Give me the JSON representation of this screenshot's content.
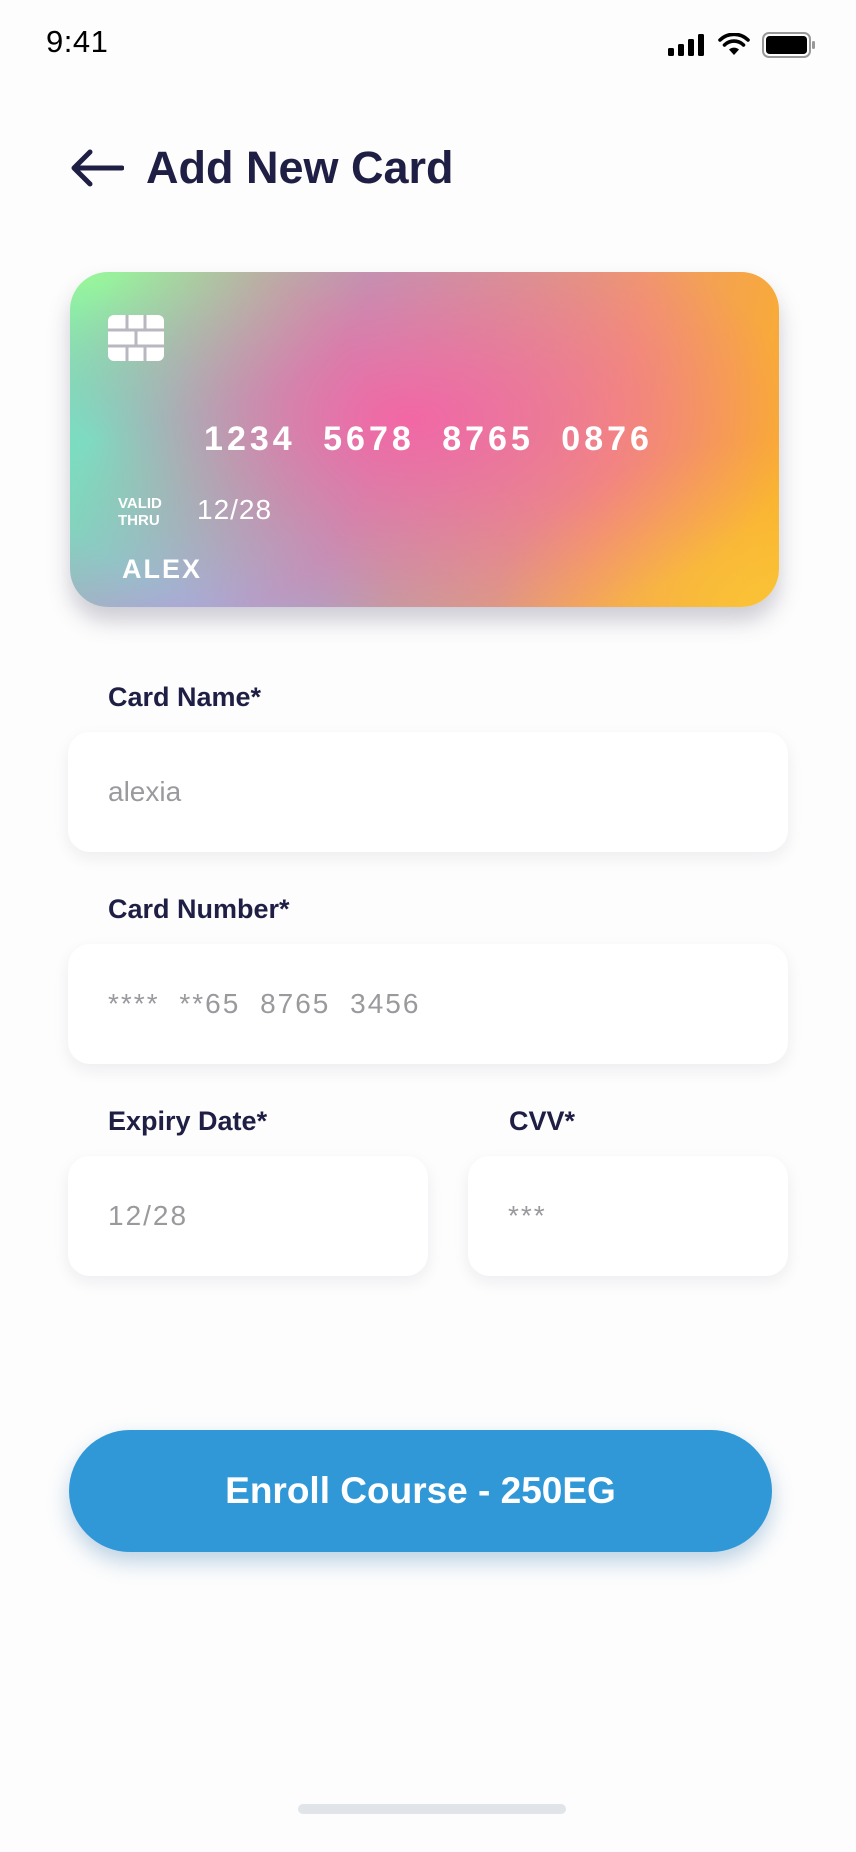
{
  "status_bar": {
    "time": "9:41",
    "icons": [
      "signal-icon",
      "wifi-icon",
      "battery-icon"
    ]
  },
  "header": {
    "back_icon": "arrow-left-icon",
    "title": "Add New Card"
  },
  "card": {
    "chip_icon": "card-chip-icon",
    "number": "1234 5678 8765 0876",
    "valid_label_line1": "VALID",
    "valid_label_line2": "THRU",
    "expiry": "12/28",
    "holder": "ALEX"
  },
  "form": {
    "card_name": {
      "label": "Card Name*",
      "placeholder": "alexia"
    },
    "card_number": {
      "label": "Card Number*",
      "placeholder": "**** **65 8765 3456"
    },
    "expiry_date": {
      "label": "Expiry Date*",
      "placeholder": "12/28"
    },
    "cvv": {
      "label": "CVV*",
      "placeholder": "***"
    }
  },
  "actions": {
    "enroll_label": "Enroll Course - 250EG"
  },
  "colors": {
    "title": "#1f1e44",
    "button": "#3198d8",
    "placeholder": "#8f8f93"
  }
}
